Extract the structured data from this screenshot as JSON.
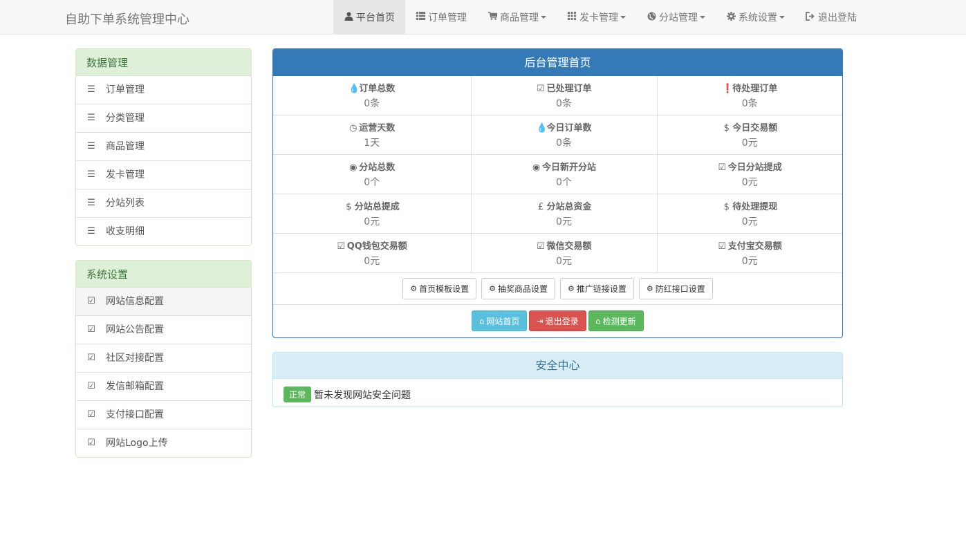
{
  "navbar": {
    "brand": "自助下单系统管理中心",
    "items": [
      {
        "label": "平台首页",
        "icon": "user-icon",
        "glyph": "👤"
      },
      {
        "label": "订单管理",
        "icon": "list-icon",
        "glyph": "☰"
      },
      {
        "label": "商品管理",
        "icon": "shopping-cart-icon",
        "glyph": "🛒"
      },
      {
        "label": "发卡管理",
        "icon": "grid-icon",
        "glyph": "▦"
      },
      {
        "label": "分站管理",
        "icon": "globe-icon",
        "glyph": "◉"
      },
      {
        "label": "系统设置",
        "icon": "gear-icon",
        "glyph": "⚙"
      },
      {
        "label": "退出登陆",
        "icon": "logout-icon",
        "glyph": "⇥"
      }
    ]
  },
  "sidebar": {
    "data_panel": {
      "title": "数据管理",
      "items": [
        {
          "label": "订单管理",
          "icon": "list-icon"
        },
        {
          "label": "分类管理",
          "icon": "list-icon"
        },
        {
          "label": "商品管理",
          "icon": "list-icon"
        },
        {
          "label": "发卡管理",
          "icon": "list-icon"
        },
        {
          "label": "分站列表",
          "icon": "list-icon"
        },
        {
          "label": "收支明细",
          "icon": "list-icon"
        }
      ]
    },
    "settings_panel": {
      "title": "系统设置",
      "items": [
        {
          "label": "网站信息配置",
          "icon": "edit-icon"
        },
        {
          "label": "网站公告配置",
          "icon": "edit-icon"
        },
        {
          "label": "社区对接配置",
          "icon": "edit-icon"
        },
        {
          "label": "发信邮箱配置",
          "icon": "edit-icon"
        },
        {
          "label": "支付接口配置",
          "icon": "edit-icon"
        },
        {
          "label": "网站Logo上传",
          "icon": "edit-icon"
        }
      ]
    }
  },
  "main": {
    "title": "后台管理首页",
    "stats": [
      [
        {
          "label": "订单总数",
          "value": "0条",
          "icon": "tint-icon",
          "glyph": "💧"
        },
        {
          "label": "已处理订单",
          "value": "0条",
          "icon": "check-square-icon",
          "glyph": "☑"
        },
        {
          "label": "待处理订单",
          "value": "0条",
          "icon": "info-circle-icon",
          "glyph": "❗"
        }
      ],
      [
        {
          "label": "运营天数",
          "value": "1天",
          "icon": "clock-icon",
          "glyph": "◷"
        },
        {
          "label": "今日订单数",
          "value": "0条",
          "icon": "tint-icon",
          "glyph": "💧"
        },
        {
          "label": "今日交易额",
          "value": "0元",
          "icon": "dollar-icon",
          "glyph": "$"
        }
      ],
      [
        {
          "label": "分站总数",
          "value": "0个",
          "icon": "globe-icon",
          "glyph": "◉"
        },
        {
          "label": "今日新开分站",
          "value": "0个",
          "icon": "globe-icon",
          "glyph": "◉"
        },
        {
          "label": "今日分站提成",
          "value": "0元",
          "icon": "check-square-icon",
          "glyph": "☑"
        }
      ],
      [
        {
          "label": "分站总提成",
          "value": "0元",
          "icon": "dollar-icon",
          "glyph": "$"
        },
        {
          "label": "分站总资金",
          "value": "0元",
          "icon": "pound-icon",
          "glyph": "£"
        },
        {
          "label": "待处理提现",
          "value": "0元",
          "icon": "dollar-icon",
          "glyph": "$"
        }
      ],
      [
        {
          "label": "QQ钱包交易额",
          "value": "0元",
          "icon": "check-square-icon",
          "glyph": "☑"
        },
        {
          "label": "微信交易额",
          "value": "0元",
          "icon": "check-square-icon",
          "glyph": "☑"
        },
        {
          "label": "支付宝交易额",
          "value": "0元",
          "icon": "check-square-icon",
          "glyph": "☑"
        }
      ]
    ],
    "setting_buttons": [
      {
        "label": "首页模板设置",
        "icon": "gear-icon"
      },
      {
        "label": "抽奖商品设置",
        "icon": "gear-icon"
      },
      {
        "label": "推广链接设置",
        "icon": "gear-icon"
      },
      {
        "label": "防红接口设置",
        "icon": "gear-icon"
      }
    ],
    "action_buttons": {
      "home": {
        "label": "网站首页",
        "icon": "home-icon",
        "color": "#5bc0de"
      },
      "logout": {
        "label": "退出登录",
        "icon": "logout-icon",
        "color": "#d9534f"
      },
      "update": {
        "label": "检测更新",
        "icon": "home-icon",
        "color": "#5cb85c"
      }
    }
  },
  "security": {
    "title": "安全中心",
    "status_badge": "正常",
    "message": "暂未发现网站安全问题"
  },
  "colors": {
    "primary": "#337ab7",
    "success_panel": "#dff0d8",
    "info_panel": "#d9edf7"
  }
}
